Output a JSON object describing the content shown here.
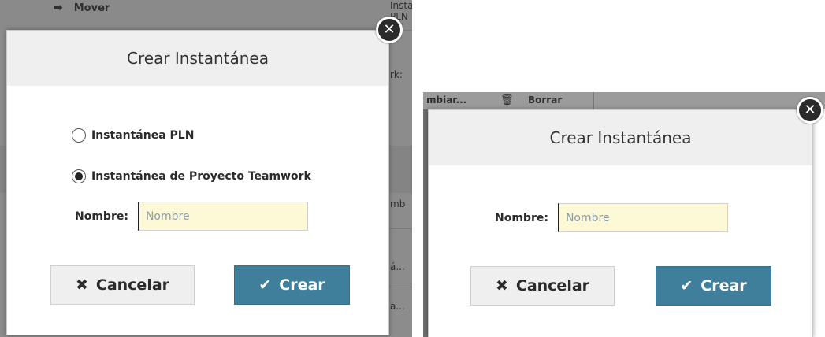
{
  "left_background": {
    "menu_item_label": "Mover",
    "peek_top": "Instantánea PLN",
    "peek_mid": "rk:",
    "peek_col": "mb",
    "peek_row1": "á...",
    "peek_row2": "a..."
  },
  "right_background": {
    "cambiar_label": "mbiar...",
    "borrar_label": "Borrar"
  },
  "dialog_left": {
    "title": "Crear Instantánea",
    "options": [
      {
        "label": "Instantánea PLN",
        "checked": false
      },
      {
        "label": "Instantánea de Proyecto Teamwork",
        "checked": true
      }
    ],
    "name_label": "Nombre:",
    "name_placeholder": "Nombre",
    "name_value": "",
    "cancel_label": "Cancelar",
    "create_label": "Crear"
  },
  "dialog_right": {
    "title": "Crear Instantánea",
    "name_label": "Nombre:",
    "name_placeholder": "Nombre",
    "name_value": "",
    "cancel_label": "Cancelar",
    "create_label": "Crear"
  },
  "icons": {
    "close": "close-circle-icon",
    "cancel": "x-icon",
    "create": "checkmark-icon",
    "move": "arrow-right-icon",
    "trash": "trash-icon"
  },
  "colors": {
    "create_button": "#3f7f9c",
    "input_bg": "#fdf9d6",
    "overlay": "#8c8c8c"
  }
}
